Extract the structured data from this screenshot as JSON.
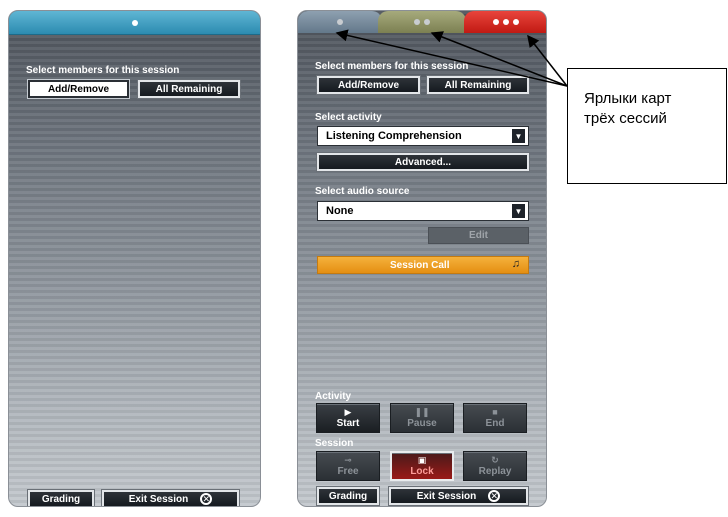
{
  "left_panel": {
    "members_label": "Select members for this session",
    "add_remove": "Add/Remove",
    "all_remaining": "All Remaining",
    "grading": "Grading",
    "exit_session": "Exit Session",
    "tab_color": "#2c8bb0"
  },
  "right_panel": {
    "tab_colors": [
      "#63788a",
      "#7c8052",
      "#c11a13"
    ],
    "members_label": "Select members for this session",
    "add_remove": "Add/Remove",
    "all_remaining": "All Remaining",
    "activity_label": "Select activity",
    "activity_value": "Listening Comprehension",
    "advanced": "Advanced...",
    "audio_label": "Select audio source",
    "audio_value": "None",
    "edit": "Edit",
    "session_call": "Session Call",
    "activity_section": "Activity",
    "start": "Start",
    "pause": "Pause",
    "end": "End",
    "session_section": "Session",
    "free": "Free",
    "lock": "Lock",
    "replay": "Replay",
    "grading": "Grading",
    "exit_session": "Exit Session"
  },
  "callout": {
    "line1": "Ярлыки карт",
    "line2": "трёх сессий"
  }
}
